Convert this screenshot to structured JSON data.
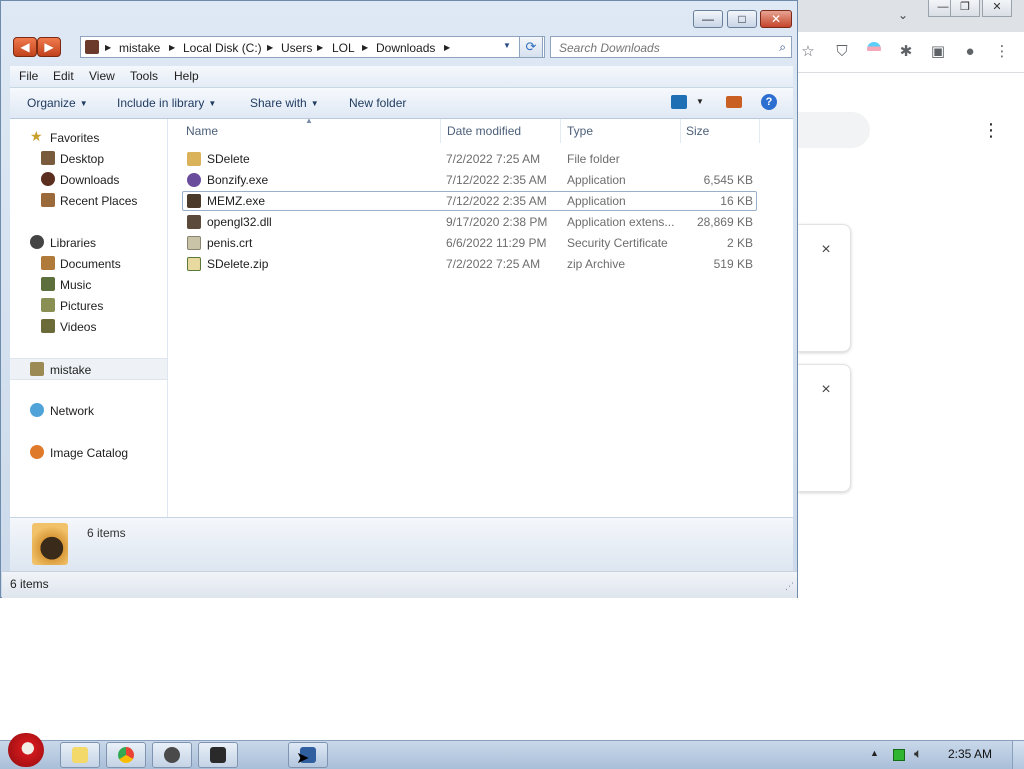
{
  "chrome": {
    "close_label": "×"
  },
  "explorer": {
    "window_controls": {
      "minimize": "—",
      "maximize": "□",
      "close": "✕"
    },
    "breadcrumb": [
      "mistake",
      "Local Disk (C:)",
      "Users",
      "LOL",
      "Downloads"
    ],
    "search_placeholder": "Search Downloads",
    "menu": [
      "File",
      "Edit",
      "View",
      "Tools",
      "Help"
    ],
    "commands": {
      "organize": "Organize",
      "include": "Include in library",
      "share": "Share with",
      "new_folder": "New folder"
    },
    "nav": {
      "favorites": "Favorites",
      "favorites_items": [
        "Desktop",
        "Downloads",
        "Recent Places"
      ],
      "libraries": "Libraries",
      "libraries_items": [
        "Documents",
        "Music",
        "Pictures",
        "Videos"
      ],
      "computer": "mistake",
      "network": "Network",
      "catalog": "Image Catalog"
    },
    "columns": {
      "name": "Name",
      "date": "Date modified",
      "type": "Type",
      "size": "Size"
    },
    "files": [
      {
        "name": "SDelete",
        "date": "7/2/2022 7:25 AM",
        "type": "File folder",
        "size": ""
      },
      {
        "name": "Bonzify.exe",
        "date": "7/12/2022 2:35 AM",
        "type": "Application",
        "size": "6,545 KB"
      },
      {
        "name": "MEMZ.exe",
        "date": "7/12/2022 2:35 AM",
        "type": "Application",
        "size": "16 KB"
      },
      {
        "name": "opengl32.dll",
        "date": "9/17/2020 2:38 PM",
        "type": "Application extens...",
        "size": "28,869 KB"
      },
      {
        "name": "penis.crt",
        "date": "6/6/2022 11:29 PM",
        "type": "Security Certificate",
        "size": "2 KB"
      },
      {
        "name": "SDelete.zip",
        "date": "7/2/2022 7:25 AM",
        "type": "zip Archive",
        "size": "519 KB"
      }
    ],
    "details_text": "6 items",
    "status_text": "6 items"
  },
  "taskbar": {
    "time": "2:35 AM"
  },
  "colors": {
    "accent": "#c1421b",
    "selection_border": "#9ab0c8",
    "taskbar": "#b8cae0"
  }
}
